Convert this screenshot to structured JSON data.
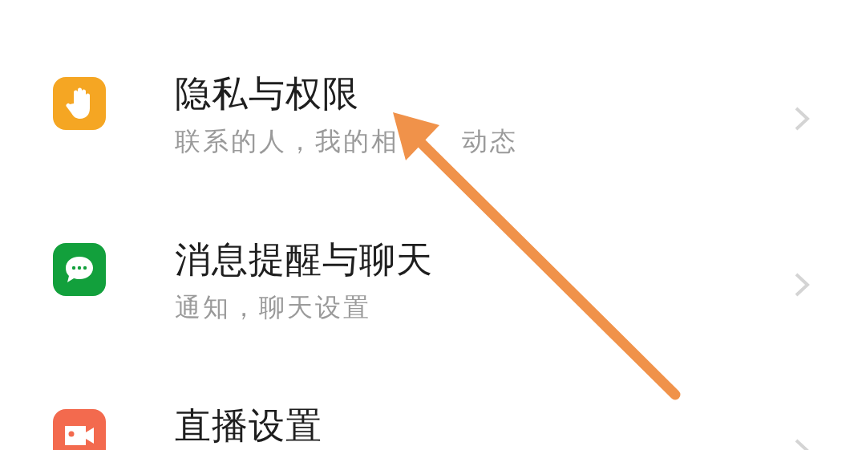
{
  "settings": [
    {
      "kind": "hand",
      "color": "#f5a623",
      "title": "隐私与权限",
      "subtitle_parts": [
        "联系的人，我的相",
        "动态"
      ]
    },
    {
      "kind": "chat",
      "color": "#12a03c",
      "title": "消息提醒与聊天",
      "subtitle_parts": [
        "通知，聊天设置"
      ]
    },
    {
      "kind": "video",
      "color": "#f36a4e",
      "title": "直播设置"
    }
  ]
}
